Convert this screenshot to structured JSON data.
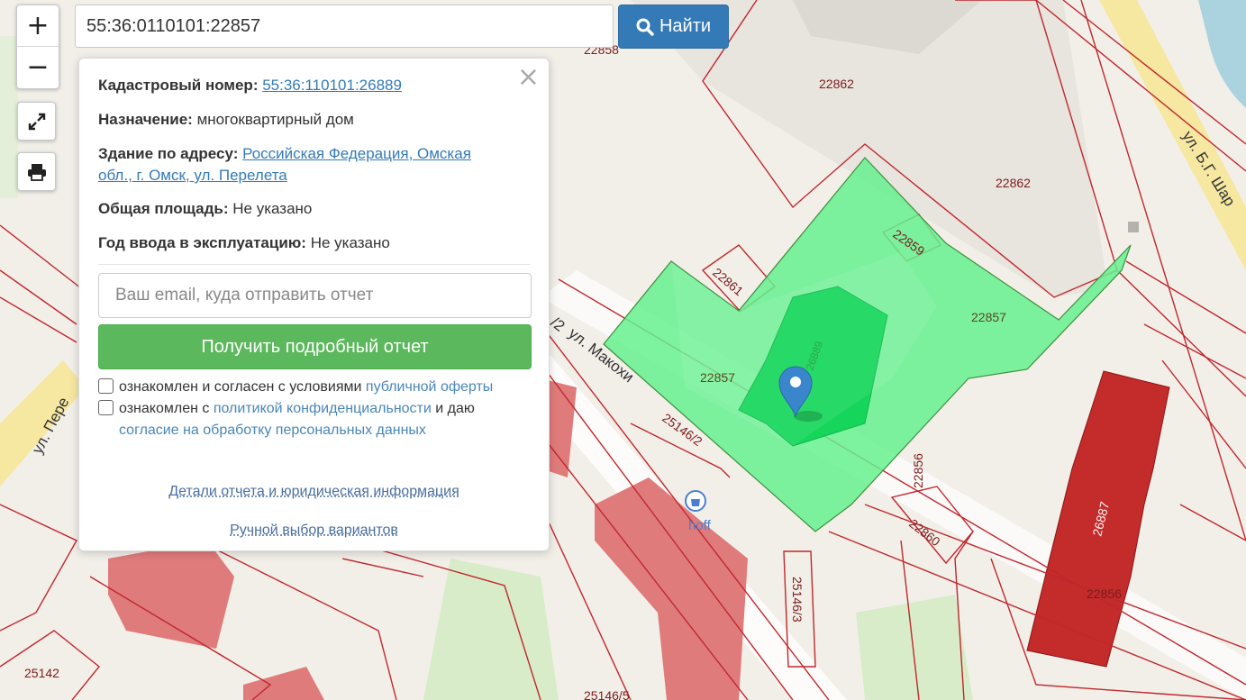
{
  "search": {
    "value": "55:36:0110101:22857",
    "button_label": "Найти"
  },
  "zoom": {
    "in": "+",
    "out": "−"
  },
  "tools": {
    "fullscreen_icon": "expand-icon",
    "print_icon": "printer-icon"
  },
  "popup": {
    "close": "×",
    "cadastral_label": "Кадастровый номер:",
    "cadastral_value": "55:36:110101:26889",
    "purpose_label": "Назначение:",
    "purpose_value": "многоквартирный дом",
    "address_label": "Здание по адресу:",
    "address_line1": "Российская Федерация, Омская",
    "address_line2": "обл., г. Омск, ул. Перелета",
    "area_label": "Общая площадь:",
    "area_value": "Не указано",
    "year_label": "Год ввода в эксплуатацию:",
    "year_value": "Не указано",
    "email_placeholder": "Ваш email, куда отправить отчет",
    "report_button": "Получить подробный отчет",
    "consent1_text": "ознакомлен и согласен с условиями",
    "consent1_link": "публичной оферты",
    "consent2_text_a": "ознакомлен с",
    "consent2_link_a": "политикой конфиденциальности",
    "consent2_text_b": "и даю",
    "consent2_link_b": "согласие на обработку персональных данных",
    "details_link": "Детали отчета и юридическая информация",
    "manual_link": "Ручной выбор вариантов"
  },
  "map": {
    "parcel_labels": [
      "22862",
      "22862",
      "22859",
      "22861",
      "22857",
      "22857",
      "25146/2",
      "22856",
      "22860",
      "25146/3",
      "26887",
      "22856",
      "25142",
      "25146/5",
      "22858",
      "26889"
    ],
    "street_labels": [
      "ул. Б.Г. Шар",
      "ул. Пере",
      "ул. Макохи",
      "/2"
    ],
    "poi_label": "hoff",
    "colors": {
      "selected_fill": "#66f08f",
      "building_fill": "#15d65a",
      "red_building": "#c42b2b",
      "pink_building": "#e07b7b",
      "boundary": "#c0272d",
      "road_yellow": "#f6e7a1",
      "marker": "#3a86cc"
    },
    "marker_icon": "map-pin-icon"
  }
}
